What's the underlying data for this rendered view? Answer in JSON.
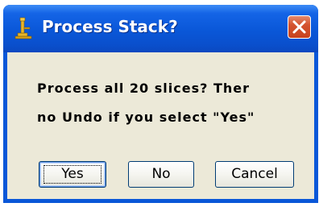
{
  "window": {
    "title": "Process Stack?",
    "icon": "microscope-icon",
    "close_icon": "close-icon"
  },
  "dialog": {
    "message_line1": "Process all 20 slices?  Ther",
    "message_line2": "no Undo if you select \"Yes\""
  },
  "buttons": {
    "yes_label": "Yes",
    "no_label": "No",
    "cancel_label": "Cancel"
  },
  "colors": {
    "titlebar": "#0a57d8",
    "client": "#ece9d8",
    "close_button": "#d4532f",
    "icon_gold": "#d9a21a"
  }
}
